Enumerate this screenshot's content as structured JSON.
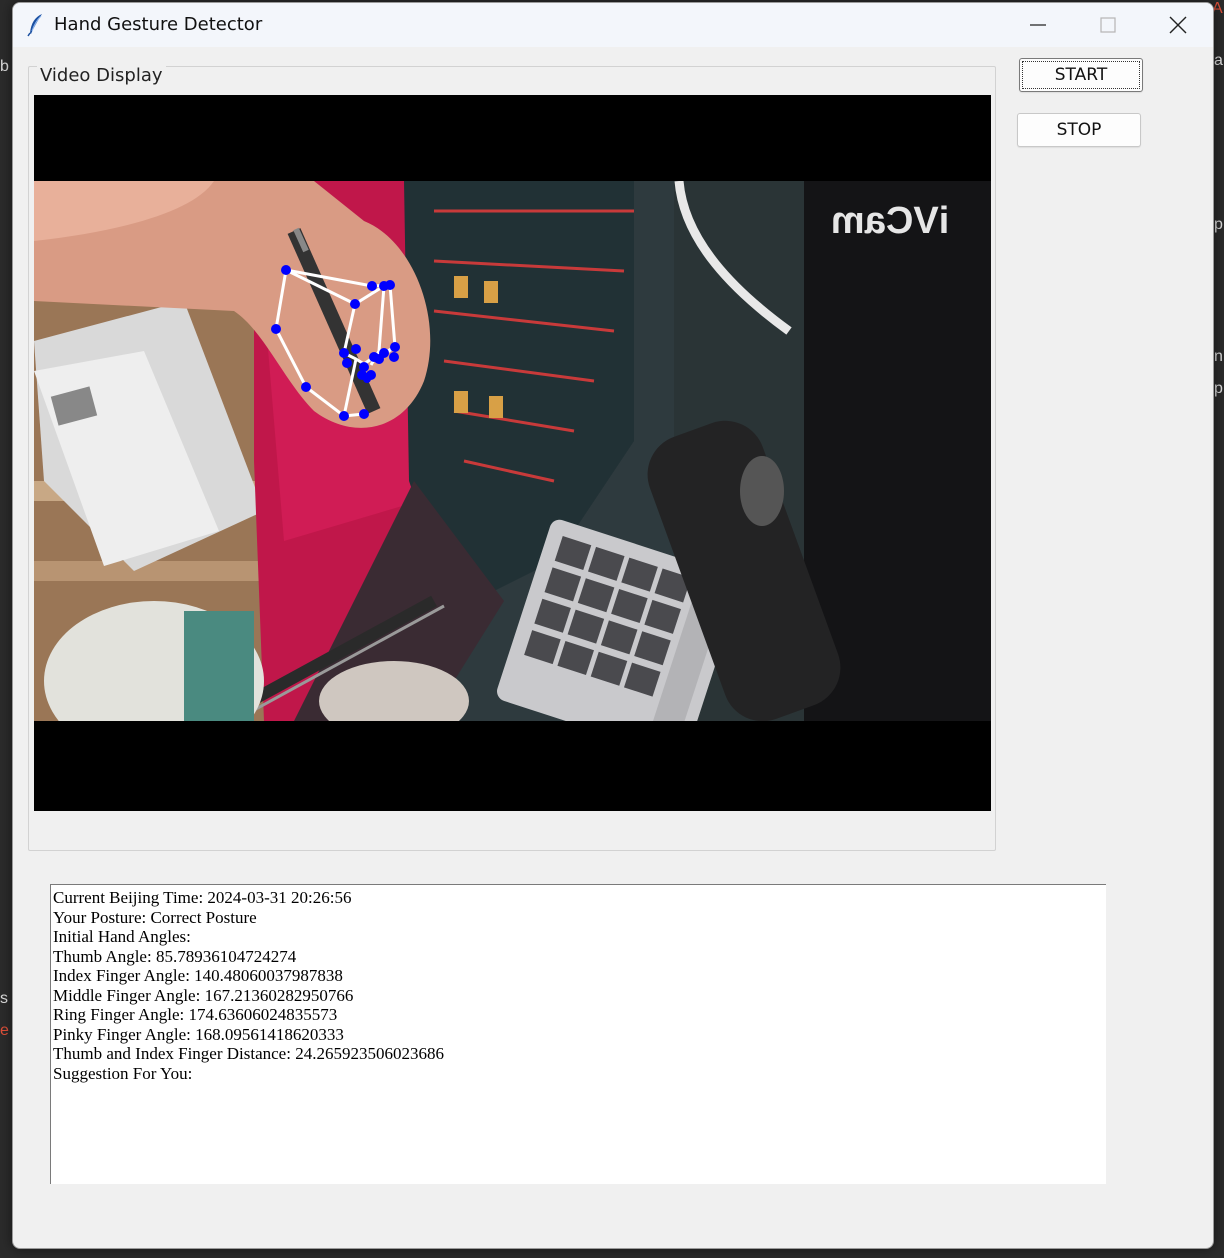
{
  "window": {
    "title": "Hand Gesture Detector"
  },
  "video_panel": {
    "label": "Video Display",
    "watermark": "iVCam"
  },
  "controls": {
    "start_label": "START",
    "stop_label": "STOP"
  },
  "output": {
    "lines": [
      "Current Beijing Time: 2024-03-31 20:26:56",
      "Your Posture: Correct Posture",
      "Initial Hand Angles:",
      "Thumb Angle: 85.78936104724274",
      "Index Finger Angle: 140.48060037987838",
      "Middle Finger Angle: 167.21360282950766",
      "Ring Finger Angle: 174.63606024835573",
      "Pinky Finger Angle: 168.09561418620333",
      "Thumb and Index Finger Distance: 24.265923506023686",
      "Suggestion For You:"
    ]
  },
  "colors": {
    "landmark": "#0000ff",
    "connection": "#ffffff"
  }
}
